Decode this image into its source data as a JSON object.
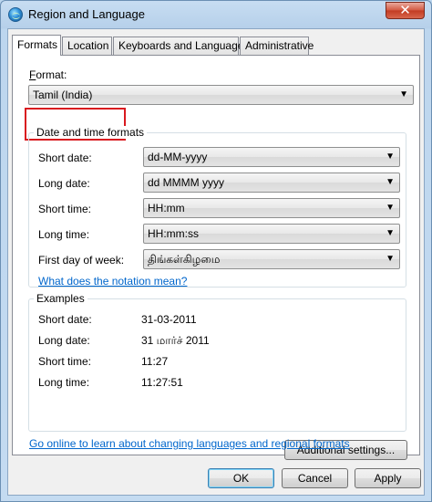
{
  "window": {
    "title": "Region and Language",
    "close_symbol": "✕"
  },
  "tabs": [
    {
      "label": "Formats",
      "active": true
    },
    {
      "label": "Location",
      "active": false
    },
    {
      "label": "Keyboards and Languages",
      "active": false
    },
    {
      "label": "Administrative",
      "active": false
    }
  ],
  "formats": {
    "format_label": "Format:",
    "format_value": "Tamil (India)",
    "date_time_group_title": "Date and time formats",
    "short_date_label": "Short date:",
    "short_date_value": "dd-MM-yyyy",
    "long_date_label": "Long date:",
    "long_date_value": "dd MMMM yyyy",
    "short_time_label": "Short time:",
    "short_time_value": "HH:mm",
    "long_time_label": "Long time:",
    "long_time_value": "HH:mm:ss",
    "first_day_label": "First day of week:",
    "first_day_value": "திங்கள்கிழமை",
    "notation_link": "What does the notation mean?",
    "examples_group_title": "Examples",
    "ex_short_date_label": "Short date:",
    "ex_short_date_value": "31-03-2011",
    "ex_long_date_label": "Long date:",
    "ex_long_date_value": "31 மார்ச் 2011",
    "ex_short_time_label": "Short time:",
    "ex_short_time_value": "11:27",
    "ex_long_time_label": "Long time:",
    "ex_long_time_value": "11:27:51",
    "additional_settings_button": "Additional settings...",
    "online_link": "Go online to learn about changing languages and regional formats"
  },
  "footer": {
    "ok": "OK",
    "cancel": "Cancel",
    "apply": "Apply"
  },
  "icons": {
    "combo_arrow": "chevron-down-icon",
    "app": "globe-icon",
    "close": "close-icon"
  },
  "colors": {
    "link": "#0066cc",
    "highlight": "#d9191f"
  }
}
